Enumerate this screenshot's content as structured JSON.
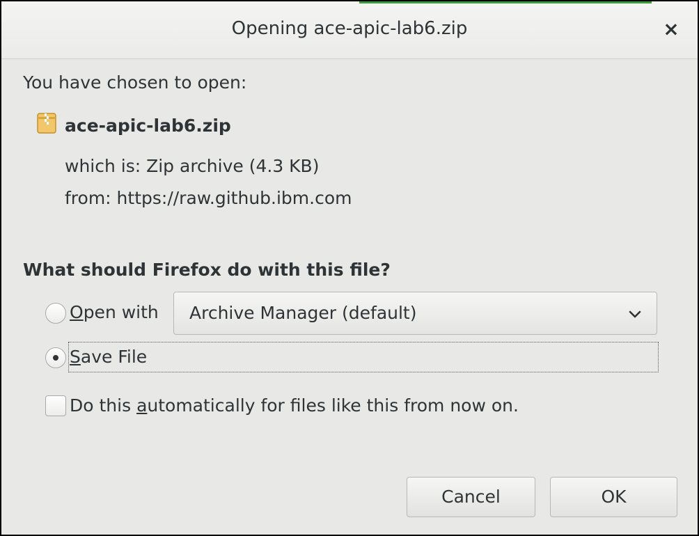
{
  "window": {
    "title": "Opening ace-apic-lab6.zip",
    "close_glyph": "×",
    "accent_color": "#3e9a3e"
  },
  "file": {
    "intro": "You have chosen to open:",
    "name": "ace-apic-lab6.zip",
    "icon": "zip-archive-icon",
    "which_is": "which is: Zip archive (4.3 KB)",
    "from": "from: https://raw.github.ibm.com"
  },
  "action": {
    "question": "What should Firefox do with this file?",
    "open_with": {
      "mnemonic": "O",
      "rest": "pen with",
      "selected": false
    },
    "app_select": {
      "value": "Archive Manager (default)",
      "icon": "chevron-down-icon"
    },
    "save_file": {
      "mnemonic": "S",
      "rest": "ave File",
      "selected": true
    },
    "auto": {
      "prefix": "Do this ",
      "mnemonic": "a",
      "rest": "utomatically for files like this from now on.",
      "checked": false
    }
  },
  "buttons": {
    "cancel": "Cancel",
    "ok": "OK"
  }
}
